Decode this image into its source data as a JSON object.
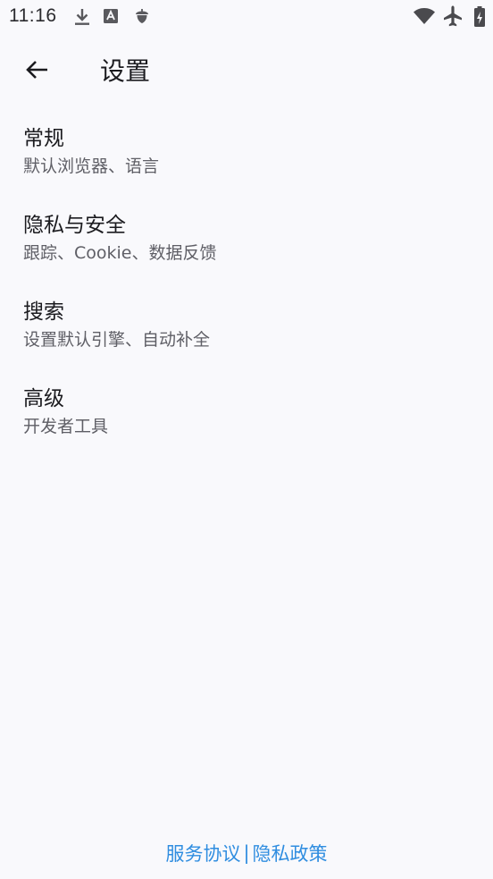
{
  "status_bar": {
    "time": "11:16",
    "left_icons": [
      "download-icon",
      "font-app-icon",
      "acorn-icon"
    ],
    "right_icons": [
      "wifi-icon",
      "airplane-mode-icon",
      "battery-charging-icon"
    ]
  },
  "top_bar": {
    "back_icon": "arrow-back-icon",
    "title": "设置"
  },
  "settings": {
    "items": [
      {
        "title": "常规",
        "subtitle": "默认浏览器、语言"
      },
      {
        "title": "隐私与安全",
        "subtitle": "跟踪、Cookie、数据反馈"
      },
      {
        "title": "搜索",
        "subtitle": "设置默认引擎、自动补全"
      },
      {
        "title": "高级",
        "subtitle": "开发者工具"
      }
    ]
  },
  "footer": {
    "terms_label": "服务协议",
    "separator": "|",
    "privacy_label": "隐私政策",
    "link_color": "#2f8de0"
  }
}
